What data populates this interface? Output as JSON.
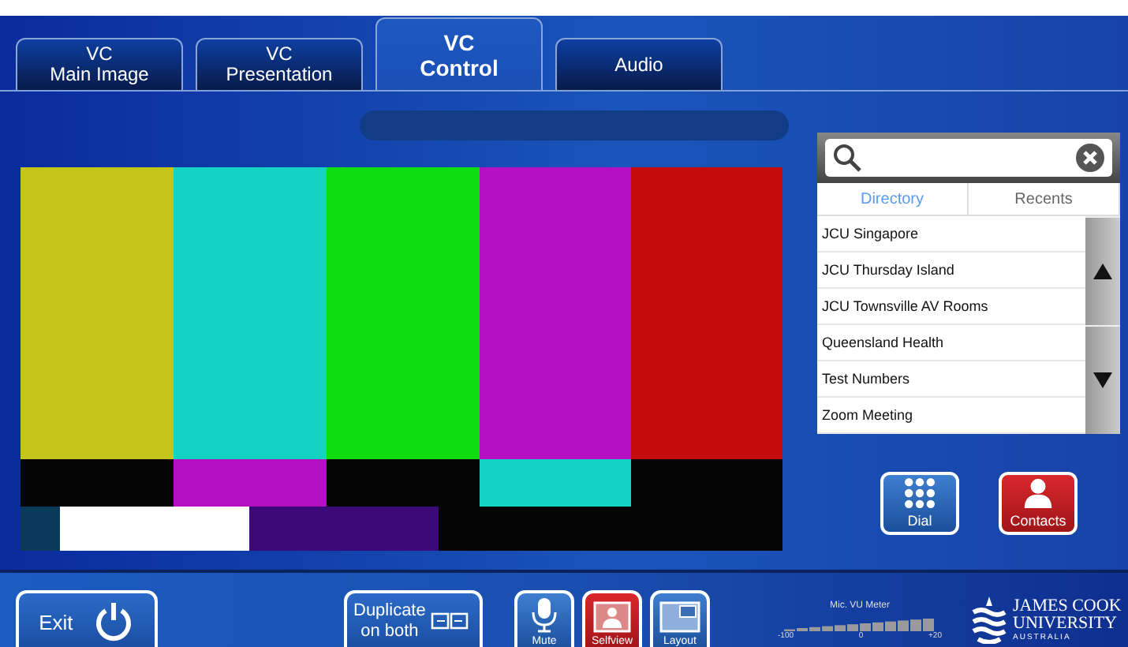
{
  "tabs": [
    {
      "label": "VC\nMain Image",
      "selected": false
    },
    {
      "label": "VC\nPresentation",
      "selected": false
    },
    {
      "label": "VC\nControl",
      "selected": true
    },
    {
      "label": "Audio",
      "selected": false
    }
  ],
  "directory": {
    "tabs": [
      {
        "label": "Directory",
        "selected": true
      },
      {
        "label": "Recents",
        "selected": false
      }
    ],
    "entries": [
      {
        "name": "JCU Singapore"
      },
      {
        "name": "JCU Thursday Island"
      },
      {
        "name": "JCU Townsville AV Rooms"
      },
      {
        "name": "Queensland Health"
      },
      {
        "name": "Test Numbers"
      },
      {
        "name": "Zoom Meeting"
      }
    ]
  },
  "call_buttons": [
    {
      "kind": "dial",
      "label": "Dial",
      "selected": false
    },
    {
      "kind": "contacts",
      "label": "Contacts",
      "selected": true
    }
  ],
  "bottom_bar": {
    "exit": "Exit",
    "duplicate": "Duplicate\non both",
    "toggles": [
      {
        "kind": "mute",
        "label": "Mute",
        "on": false
      },
      {
        "kind": "selfview",
        "label": "Selfview",
        "on": true
      },
      {
        "kind": "layout",
        "label": "Layout",
        "on": false
      }
    ],
    "vu_meter": {
      "title": "Mic. VU Meter",
      "ticks": [
        "-100",
        "0",
        "+20"
      ]
    },
    "logo": {
      "line1": "JAMES COOK",
      "line2": "UNIVERSITY",
      "line3": "AUSTRALIA"
    }
  }
}
